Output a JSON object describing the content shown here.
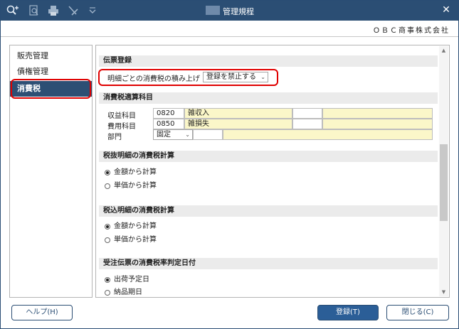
{
  "window": {
    "title": "管理規程",
    "company": "ＯＢＣ商事株式会社"
  },
  "toolbar": {
    "icons": [
      "search-plus-icon",
      "preview-icon",
      "print-icon",
      "tools-icon",
      "filter-icon"
    ],
    "close_glyph": "✕"
  },
  "nav": {
    "items": [
      {
        "label": "販売管理",
        "active": false
      },
      {
        "label": "債権管理",
        "active": false
      },
      {
        "label": "消費税",
        "active": true
      }
    ]
  },
  "sections": {
    "voucher": {
      "header": "伝票登録",
      "tax_accum_label": "明細ごとの消費税の積み上げ",
      "tax_accum_value": "登録を禁止する"
    },
    "tax_adjust": {
      "header": "消費税適算科目",
      "rows": [
        {
          "label": "収益科目",
          "code": "0820",
          "name": "雑収入"
        },
        {
          "label": "費用科目",
          "code": "0850",
          "name": "雑損失"
        },
        {
          "label": "部門",
          "code": "固定",
          "name": ""
        }
      ]
    },
    "tax_excl": {
      "header": "税抜明細の消費税計算",
      "options": [
        {
          "label": "金額から計算",
          "selected": true
        },
        {
          "label": "単価から計算",
          "selected": false
        }
      ]
    },
    "tax_incl": {
      "header": "税込明細の消費税計算",
      "options": [
        {
          "label": "金額から計算",
          "selected": true
        },
        {
          "label": "単価から計算",
          "selected": false
        }
      ]
    },
    "order_date": {
      "header": "受注伝票の消費税率判定日付",
      "options": [
        {
          "label": "出荷予定日",
          "selected": true
        },
        {
          "label": "納品期日",
          "selected": false
        }
      ]
    }
  },
  "buttons": {
    "help": "ヘルプ(H)",
    "save": "登録(T)",
    "close": "閉じる(C)"
  }
}
